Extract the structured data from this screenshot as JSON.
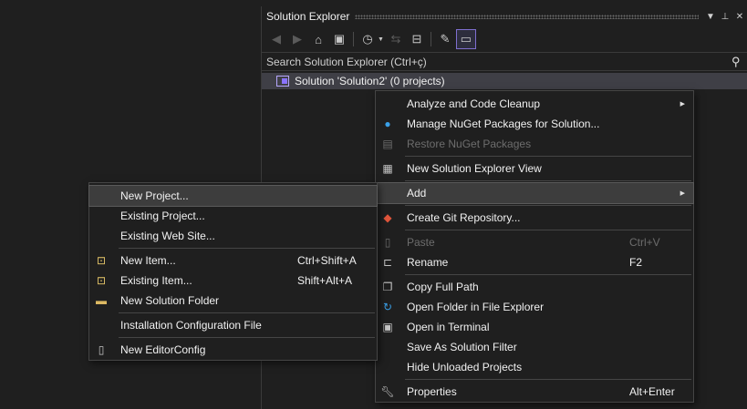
{
  "solution_explorer": {
    "title": "Solution Explorer",
    "title_buttons": {
      "dropdown": "▾",
      "pin": "📌",
      "close": "✕"
    },
    "search_placeholder": "Search Solution Explorer (Ctrl+ç)",
    "tree": {
      "solution_label": "Solution 'Solution2' (0 projects)"
    }
  },
  "context_menu": {
    "items": [
      {
        "label": "Analyze and Code Cleanup",
        "submenu": true
      },
      {
        "label": "Manage NuGet Packages for Solution..."
      },
      {
        "label": "Restore NuGet Packages",
        "disabled": true
      },
      {
        "label": "New Solution Explorer View"
      },
      {
        "label": "Add",
        "submenu": true,
        "highlighted": true
      },
      {
        "label": "Create Git Repository..."
      },
      {
        "label": "Paste",
        "shortcut": "Ctrl+V",
        "disabled": true
      },
      {
        "label": "Rename",
        "shortcut": "F2"
      },
      {
        "label": "Copy Full Path"
      },
      {
        "label": "Open Folder in File Explorer"
      },
      {
        "label": "Open in Terminal"
      },
      {
        "label": "Save As Solution Filter"
      },
      {
        "label": "Hide Unloaded Projects"
      },
      {
        "label": "Properties",
        "shortcut": "Alt+Enter"
      }
    ]
  },
  "add_submenu": {
    "items": [
      {
        "label": "New Project...",
        "highlighted": true
      },
      {
        "label": "Existing Project..."
      },
      {
        "label": "Existing Web Site..."
      },
      {
        "label": "New Item...",
        "shortcut": "Ctrl+Shift+A"
      },
      {
        "label": "Existing Item...",
        "shortcut": "Shift+Alt+A"
      },
      {
        "label": "New Solution Folder"
      },
      {
        "label": "Installation Configuration File"
      },
      {
        "label": "New EditorConfig"
      }
    ]
  },
  "colors": {
    "background": "#1f1f1f",
    "menu_border": "#454545",
    "highlight": "#3d3d3d",
    "accent": "#8a73ff"
  }
}
